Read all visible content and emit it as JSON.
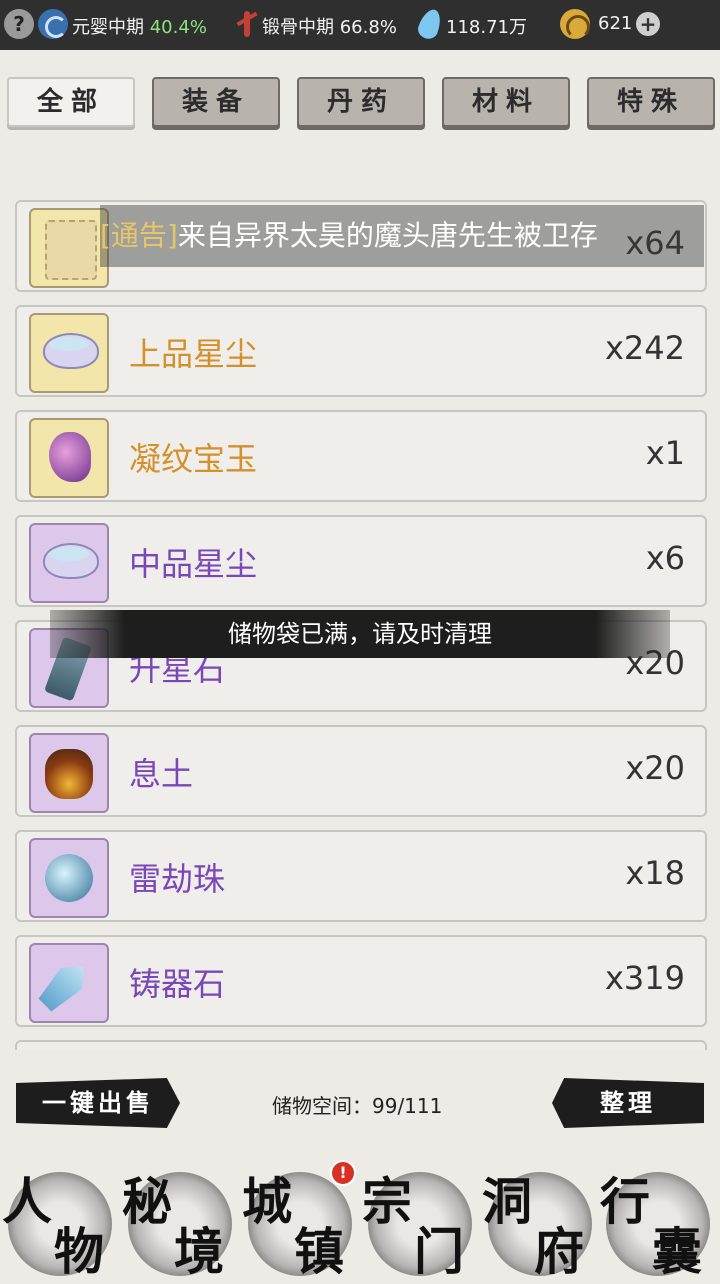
{
  "top_bar": {
    "help_icon": "?",
    "realm1_text": "元婴中期",
    "realm1_pct": "40.4%",
    "realm2_text": "锻骨中期",
    "realm2_pct": "66.8%",
    "spirit_stones": "118.71万",
    "coins": "621",
    "add_icon": "+"
  },
  "tabs": [
    "全部",
    "装备",
    "丹药",
    "材料",
    "特殊"
  ],
  "active_tab": "全部",
  "notice": {
    "tag": "[通告]",
    "text": "来自异界太昊的魔头唐先生被卫存"
  },
  "items": [
    {
      "name": "",
      "qty": "x64",
      "tier": "gold",
      "icon": "scroll-icon"
    },
    {
      "name": "上品星尘",
      "qty": "x242",
      "tier": "gold",
      "icon": "stardust-icon"
    },
    {
      "name": "凝纹宝玉",
      "qty": "x1",
      "tier": "gold",
      "icon": "jade-icon"
    },
    {
      "name": "中品星尘",
      "qty": "x6",
      "tier": "purple",
      "icon": "stardust-icon"
    },
    {
      "name": "升星石",
      "qty": "x20",
      "tier": "purple",
      "icon": "star-stone-icon"
    },
    {
      "name": "息土",
      "qty": "x20",
      "tier": "purple",
      "icon": "soil-icon"
    },
    {
      "name": "雷劫珠",
      "qty": "x18",
      "tier": "purple",
      "icon": "thunder-orb-icon"
    },
    {
      "name": "铸器石",
      "qty": "x319",
      "tier": "purple",
      "icon": "crystal-icon"
    }
  ],
  "toast": "储物袋已满，请及时清理",
  "bottom": {
    "sell_all": "一键出售",
    "capacity": "储物空间：99/111",
    "arrange": "整理"
  },
  "nav": [
    {
      "c1": "人",
      "c2": "物"
    },
    {
      "c1": "秘",
      "c2": "境"
    },
    {
      "c1": "城",
      "c2": "镇"
    },
    {
      "c1": "宗",
      "c2": "门"
    },
    {
      "c1": "洞",
      "c2": "府"
    },
    {
      "c1": "行",
      "c2": "囊"
    }
  ],
  "nav_badge": "!"
}
